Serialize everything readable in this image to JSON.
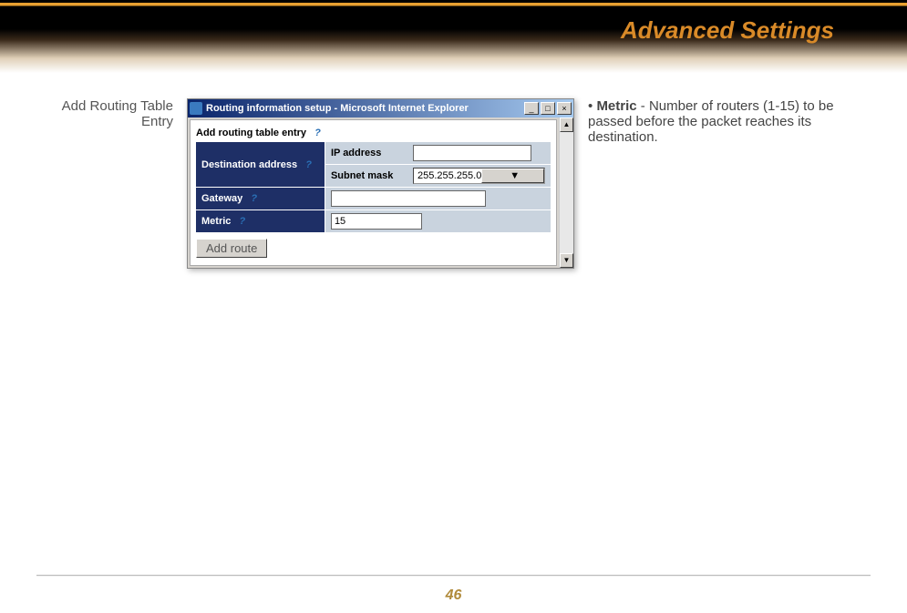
{
  "header": {
    "title": "Advanced Settings"
  },
  "left_label": "Add Routing Table Entry",
  "dialog": {
    "window_title": "Routing information setup - Microsoft Internet Explorer",
    "min_label": "_",
    "restore_label": "□",
    "close_label": "×",
    "section_title": "Add routing table entry",
    "help_icon": "?",
    "rows": {
      "dest": {
        "label": "Destination address",
        "ip_label": "IP address",
        "ip_value": "",
        "mask_label": "Subnet mask",
        "mask_value": "255.255.255.0"
      },
      "gateway": {
        "label": "Gateway",
        "value": ""
      },
      "metric": {
        "label": "Metric",
        "value": "15"
      }
    },
    "add_button": "Add route",
    "scroll_up": "▲",
    "scroll_down": "▼",
    "dropdown_arrow": "▼"
  },
  "description": {
    "bullet": "•",
    "term": "Metric",
    "text": " - Number of routers (1-15) to be passed before the packet reaches its destination."
  },
  "page_number": "46"
}
